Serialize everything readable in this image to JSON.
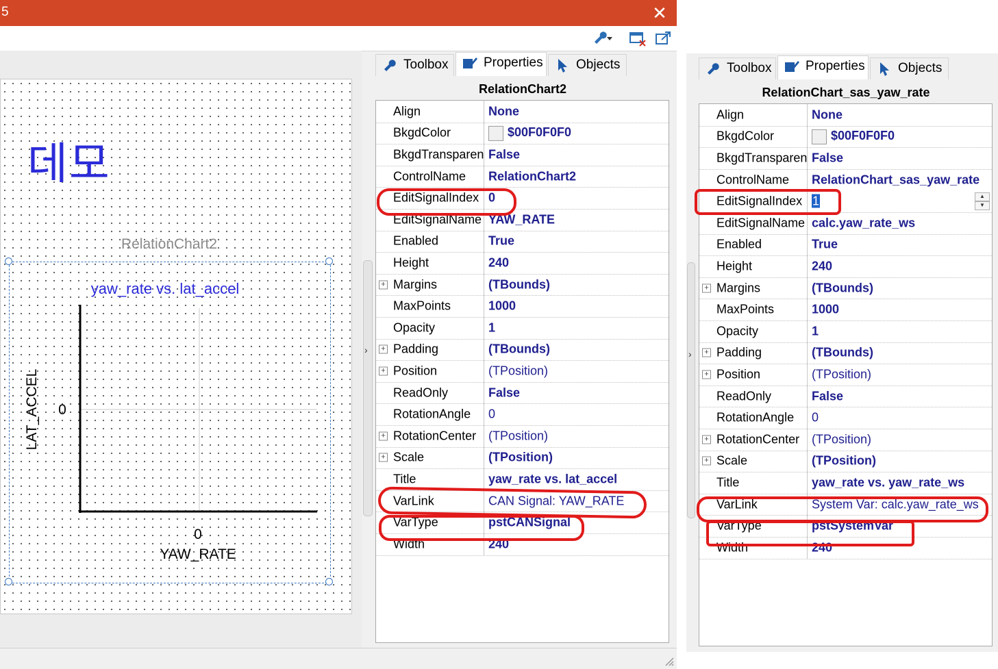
{
  "window": {
    "title": "5",
    "close_glyph": "✕",
    "toolbar_icons": [
      "wrench-dropdown-icon",
      "close-window-icon",
      "export-icon"
    ]
  },
  "designer": {
    "demo_label": "데모",
    "chart_caption": "RelationChart2",
    "chart": {
      "title": "yaw_rate vs. lat_accel",
      "xlabel": "YAW_RATE",
      "ylabel": "LAT_ACCEL",
      "x_tick": "0",
      "y_tick": "0"
    }
  },
  "tabs": [
    "Toolbox",
    "Properties",
    "Objects"
  ],
  "tab_icons": [
    "wrench-icon",
    "properties-icon",
    "cursor-icon"
  ],
  "active_tab": "Properties",
  "panel_left": {
    "title": "RelationChart2",
    "rows": [
      {
        "name": "Align",
        "value": "None",
        "bold": true
      },
      {
        "name": "BkgdColor",
        "value": "$00F0F0F0",
        "bold": true,
        "swatch": true
      },
      {
        "name": "BkgdTransparent",
        "value": "False",
        "bold": true
      },
      {
        "name": "ControlName",
        "value": "RelationChart2",
        "bold": true
      },
      {
        "name": "EditSignalIndex",
        "value": "0",
        "bold": true
      },
      {
        "name": "EditSignalName",
        "value": "YAW_RATE",
        "bold": true
      },
      {
        "name": "Enabled",
        "value": "True",
        "bold": true
      },
      {
        "name": "Height",
        "value": "240",
        "bold": true
      },
      {
        "name": "Margins",
        "value": "(TBounds)",
        "bold": true,
        "expand": true
      },
      {
        "name": "MaxPoints",
        "value": "1000",
        "bold": true
      },
      {
        "name": "Opacity",
        "value": "1",
        "bold": true
      },
      {
        "name": "Padding",
        "value": "(TBounds)",
        "bold": true,
        "expand": true
      },
      {
        "name": "Position",
        "value": "(TPosition)",
        "bold": false,
        "expand": true
      },
      {
        "name": "ReadOnly",
        "value": "False",
        "bold": true
      },
      {
        "name": "RotationAngle",
        "value": "0",
        "bold": false
      },
      {
        "name": "RotationCenter",
        "value": "(TPosition)",
        "bold": false,
        "expand": true
      },
      {
        "name": "Scale",
        "value": "(TPosition)",
        "bold": true,
        "expand": true
      },
      {
        "name": "Title",
        "value": "yaw_rate vs. lat_accel",
        "bold": true
      },
      {
        "name": "VarLink",
        "value": "CAN Signal: YAW_RATE",
        "bold": false
      },
      {
        "name": "VarType",
        "value": "pstCANSignal",
        "bold": true
      },
      {
        "name": "Width",
        "value": "240",
        "bold": true
      }
    ]
  },
  "panel_right": {
    "title": "RelationChart_sas_yaw_rate",
    "rows": [
      {
        "name": "Align",
        "value": "None",
        "bold": true
      },
      {
        "name": "BkgdColor",
        "value": "$00F0F0F0",
        "bold": true,
        "swatch": true
      },
      {
        "name": "BkgdTransparent",
        "value": "False",
        "bold": true
      },
      {
        "name": "ControlName",
        "value": "RelationChart_sas_yaw_rate",
        "bold": true
      },
      {
        "name": "EditSignalIndex",
        "value": "1",
        "bold": false,
        "editing": true
      },
      {
        "name": "EditSignalName",
        "value": "calc.yaw_rate_ws",
        "bold": true
      },
      {
        "name": "Enabled",
        "value": "True",
        "bold": true
      },
      {
        "name": "Height",
        "value": "240",
        "bold": true
      },
      {
        "name": "Margins",
        "value": "(TBounds)",
        "bold": true,
        "expand": true
      },
      {
        "name": "MaxPoints",
        "value": "1000",
        "bold": true
      },
      {
        "name": "Opacity",
        "value": "1",
        "bold": true
      },
      {
        "name": "Padding",
        "value": "(TBounds)",
        "bold": true,
        "expand": true
      },
      {
        "name": "Position",
        "value": "(TPosition)",
        "bold": false,
        "expand": true
      },
      {
        "name": "ReadOnly",
        "value": "False",
        "bold": true
      },
      {
        "name": "RotationAngle",
        "value": "0",
        "bold": false
      },
      {
        "name": "RotationCenter",
        "value": "(TPosition)",
        "bold": false,
        "expand": true
      },
      {
        "name": "Scale",
        "value": "(TPosition)",
        "bold": true,
        "expand": true
      },
      {
        "name": "Title",
        "value": "yaw_rate vs. yaw_rate_ws",
        "bold": true
      },
      {
        "name": "VarLink",
        "value": "System Var: calc.yaw_rate_ws",
        "bold": false
      },
      {
        "name": "VarType",
        "value": "pstSystemVar",
        "bold": true
      },
      {
        "name": "Width",
        "value": "240",
        "bold": true
      }
    ]
  },
  "colors": {
    "titlebar": "#d24726",
    "value_text": "#1f1f8f",
    "highlight": "#e11b1b",
    "demo_text": "#2b2bd9",
    "selection": "#3d78c2"
  }
}
